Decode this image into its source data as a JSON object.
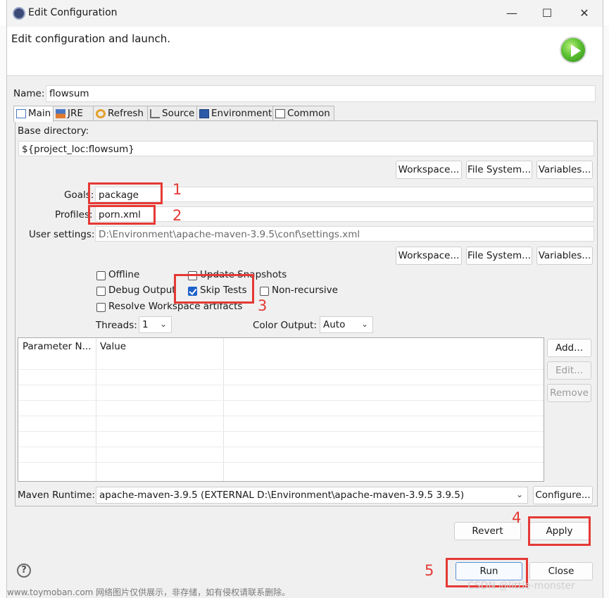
{
  "window": {
    "title": "Edit Configuration",
    "header_text": "Edit configuration and launch.",
    "minimize_glyph": "—",
    "maximize_glyph": "☐",
    "close_glyph": "✕"
  },
  "name": {
    "label": "Name:",
    "value": "flowsum"
  },
  "tabs": [
    {
      "label": "Main",
      "icon": "main-tab-icon",
      "active": true
    },
    {
      "label": "JRE",
      "icon": "jre-icon"
    },
    {
      "label": "Refresh",
      "icon": "refresh-icon"
    },
    {
      "label": "Source",
      "icon": "source-icon"
    },
    {
      "label": "Environment",
      "icon": "environment-icon"
    },
    {
      "label": "Common",
      "icon": "common-icon"
    }
  ],
  "main": {
    "base_directory_label": "Base directory:",
    "base_directory_value": "${project_loc:flowsum}",
    "buttons_row1": [
      "Workspace...",
      "File System...",
      "Variables..."
    ],
    "goals_label": "Goals:",
    "goals_value": "package",
    "profiles_label": "Profiles:",
    "profiles_value": "porn.xml",
    "user_settings_label": "User settings:",
    "user_settings_value": "D:\\Environment\\apache-maven-3.9.5\\conf\\settings.xml",
    "buttons_row2": [
      "Workspace...",
      "File System...",
      "Variables..."
    ],
    "checkboxes": {
      "offline": {
        "label": "Offline",
        "checked": false
      },
      "update_snapshots": {
        "label": "Update Snapshots",
        "checked": false
      },
      "debug_output": {
        "label": "Debug Output",
        "checked": false
      },
      "skip_tests": {
        "label": "Skip Tests",
        "checked": true
      },
      "non_recursive": {
        "label": "Non-recursive",
        "checked": false
      },
      "resolve_workspace": {
        "label": "Resolve Workspace artifacts",
        "checked": false
      }
    },
    "threads_label": "Threads:",
    "threads_value": "1",
    "color_output_label": "Color Output:",
    "color_output_value": "Auto",
    "parameter_table": {
      "columns": [
        "Parameter N...",
        "Value"
      ],
      "rows": []
    },
    "table_buttons": [
      "Add...",
      "Edit...",
      "Remove"
    ],
    "maven_runtime_label": "Maven Runtime:",
    "maven_runtime_value": "apache-maven-3.9.5 (EXTERNAL D:\\Environment\\apache-maven-3.9.5 3.9.5)",
    "configure_button": "Configure..."
  },
  "footer": {
    "revert": "Revert",
    "apply": "Apply",
    "run": "Run",
    "close": "Close",
    "help_glyph": "?"
  },
  "annotations": {
    "n1": "1",
    "n2": "2",
    "n3": "3",
    "n4": "4",
    "n5": "5"
  },
  "watermarks": {
    "bottom_left": "www.toymoban.com 网络图片仅供展示，非存储，如有侵权请联系删除。",
    "bottom_right": "CSDN @little-monster"
  },
  "colors": {
    "annotation_red": "#e53935",
    "window_bg": "#f0f0f0",
    "checkbox_checked": "#1f62c9",
    "primary_border": "#5a8fd6"
  }
}
